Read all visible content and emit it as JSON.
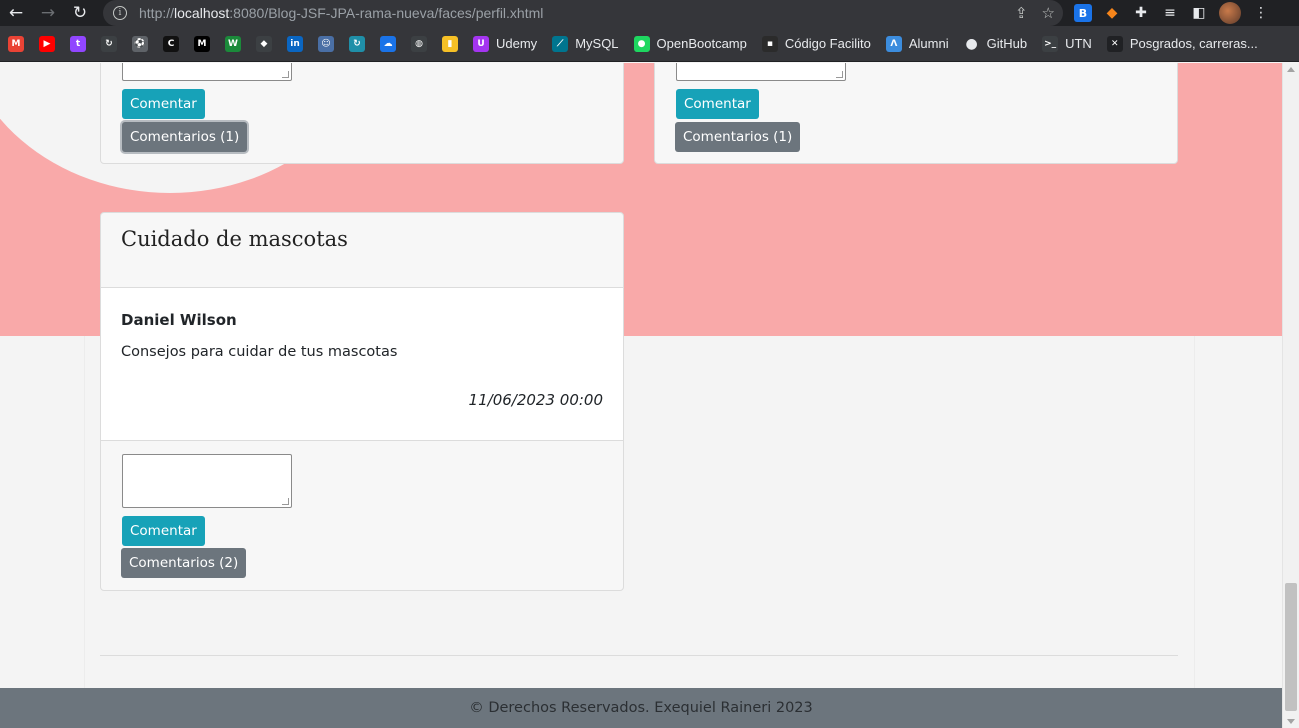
{
  "browser": {
    "url_prefix": "http://",
    "url_host": "localhost",
    "url_rest": ":8080/Blog-JSF-JPA-rama-nueva/faces/perfil.xhtml",
    "bookmarks": [
      {
        "label": "",
        "icon": "gmail-icon",
        "color": "#ea4335",
        "glyph": "M"
      },
      {
        "label": "",
        "icon": "youtube-icon",
        "color": "#ff0000",
        "glyph": "▶"
      },
      {
        "label": "",
        "icon": "twitch-icon",
        "color": "#9146ff",
        "glyph": "t"
      },
      {
        "label": "",
        "icon": "sync-icon",
        "color": "#3c4043",
        "glyph": "↻"
      },
      {
        "label": "",
        "icon": "soccer-icon",
        "color": "#5f6368",
        "glyph": "⚽"
      },
      {
        "label": "",
        "icon": "coder-icon",
        "color": "#111111",
        "glyph": "C"
      },
      {
        "label": "",
        "icon": "medium-icon",
        "color": "#000000",
        "glyph": "M"
      },
      {
        "label": "",
        "icon": "w-icon",
        "color": "#1b8a3a",
        "glyph": "W"
      },
      {
        "label": "",
        "icon": "ethereum-icon",
        "color": "#3c4043",
        "glyph": "◆"
      },
      {
        "label": "",
        "icon": "linkedin-icon",
        "color": "#0a66c2",
        "glyph": "in"
      },
      {
        "label": "",
        "icon": "profile-icon",
        "color": "#4a6fa5",
        "glyph": "☺"
      },
      {
        "label": "",
        "icon": "sync-icon",
        "color": "#1f8fa8",
        "glyph": "↻"
      },
      {
        "label": "",
        "icon": "cloud-icon",
        "color": "#1a73e8",
        "glyph": "☁"
      },
      {
        "label": "",
        "icon": "globe-icon",
        "color": "#3c4043",
        "glyph": "◍"
      },
      {
        "label": "",
        "icon": "note-icon",
        "color": "#f6c026",
        "glyph": "▮"
      },
      {
        "label": "Udemy",
        "icon": "udemy-icon",
        "color": "#a435f0",
        "glyph": "U"
      },
      {
        "label": "MySQL",
        "icon": "mysql-icon",
        "color": "#00758f",
        "glyph": "⟋"
      },
      {
        "label": "OpenBootcamp",
        "icon": "openbootcamp-icon",
        "color": "#1ed760",
        "glyph": "●"
      },
      {
        "label": "Código Facilito",
        "icon": "codigofacilito-icon",
        "color": "#2b2b2b",
        "glyph": "▪"
      },
      {
        "label": "Alumni",
        "icon": "alumni-icon",
        "color": "#3c8dde",
        "glyph": "Λ"
      },
      {
        "label": "GitHub",
        "icon": "github-icon",
        "color": "#e8eaed",
        "glyph": "●"
      },
      {
        "label": "UTN",
        "icon": "terminal-icon",
        "color": "#3c4043",
        "glyph": ">_"
      },
      {
        "label": "Posgrados, carreras...",
        "icon": "posgrados-icon",
        "color": "#202124",
        "glyph": "✕"
      }
    ]
  },
  "posts": {
    "top_left": {
      "comment_button": "Comentar",
      "comments_button": "Comentarios (1)"
    },
    "top_right": {
      "comment_button": "Comentar",
      "comments_button": "Comentarios (1)"
    },
    "pets": {
      "title": "Cuidado de mascotas",
      "author": "Daniel Wilson",
      "content": "Consejos para cuidar de tus mascotas",
      "date": "11/06/2023 00:00",
      "comment_button": "Comentar",
      "comments_button": "Comentarios (2)"
    }
  },
  "footer": {
    "text": "© Derechos Reservados. Exequiel Raineri 2023"
  },
  "colors": {
    "accent": "#17a2b8",
    "secondary": "#6c757d",
    "hero": "#f9a9a9"
  }
}
